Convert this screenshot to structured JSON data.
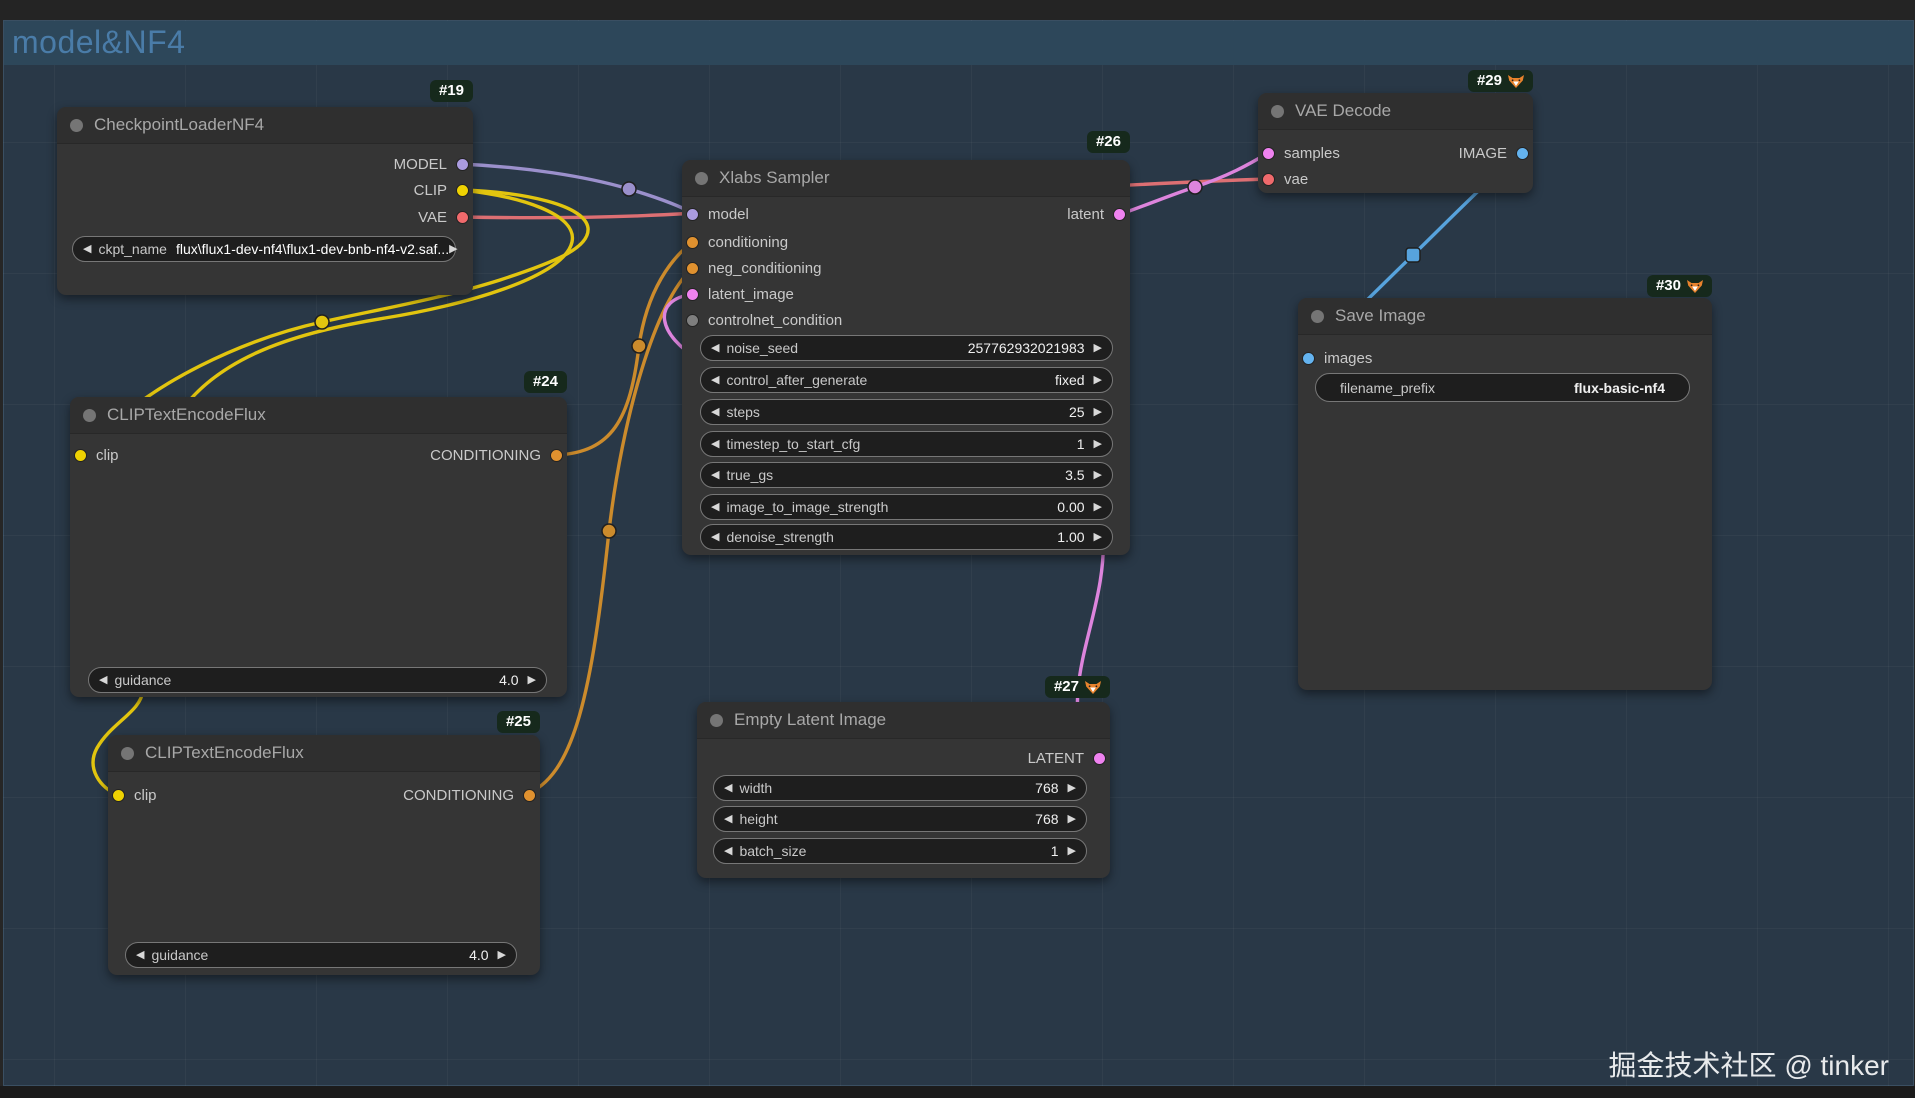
{
  "window": {
    "group_title": "model&NF4",
    "watermark": "掘金技术社区 @ tinker"
  },
  "colors": {
    "group_header": "#2d475a",
    "group_body": "#293847",
    "group_title_text": "#4a7ca8",
    "node_body": "#353535",
    "node_header": "#2f2f2f",
    "badge_bg": "#16291c",
    "slot_model_purple": "#ab9ce0",
    "slot_clip_yellow": "#efd202",
    "slot_vae_red": "#f06a6c",
    "slot_conditioning_orange": "#e0912f",
    "slot_latent_pink": "#ef82ef",
    "slot_controlnet_gray": "#7e7e7e",
    "slot_image_blue": "#64b3ef"
  },
  "nodes": {
    "checkpoint": {
      "badge": "#19",
      "title": "CheckpointLoaderNF4",
      "outputs": [
        "MODEL",
        "CLIP",
        "VAE"
      ],
      "widgets": [
        {
          "label": "ckpt_name",
          "value": "flux\\flux1-dev-nf4\\flux1-dev-bnb-nf4-v2.saf..."
        }
      ]
    },
    "clip_pos": {
      "badge": "#24",
      "title": "CLIPTextEncodeFlux",
      "inputs": [
        "clip"
      ],
      "outputs": [
        "CONDITIONING"
      ],
      "widgets": [
        {
          "label": "guidance",
          "value": "4.0"
        }
      ]
    },
    "clip_neg": {
      "badge": "#25",
      "title": "CLIPTextEncodeFlux",
      "inputs": [
        "clip"
      ],
      "outputs": [
        "CONDITIONING"
      ],
      "widgets": [
        {
          "label": "guidance",
          "value": "4.0"
        }
      ]
    },
    "sampler": {
      "badge": "#26",
      "title": "Xlabs Sampler",
      "inputs": [
        "model",
        "conditioning",
        "neg_conditioning",
        "latent_image",
        "controlnet_condition"
      ],
      "outputs": [
        "latent"
      ],
      "widgets": [
        {
          "label": "noise_seed",
          "value": "257762932021983"
        },
        {
          "label": "control_after_generate",
          "value": "fixed"
        },
        {
          "label": "steps",
          "value": "25"
        },
        {
          "label": "timestep_to_start_cfg",
          "value": "1"
        },
        {
          "label": "true_gs",
          "value": "3.5"
        },
        {
          "label": "image_to_image_strength",
          "value": "0.00"
        },
        {
          "label": "denoise_strength",
          "value": "1.00"
        }
      ]
    },
    "empty_latent": {
      "badge": "#27",
      "title": "Empty Latent Image",
      "outputs": [
        "LATENT"
      ],
      "widgets": [
        {
          "label": "width",
          "value": "768"
        },
        {
          "label": "height",
          "value": "768"
        },
        {
          "label": "batch_size",
          "value": "1"
        }
      ]
    },
    "vae_decode": {
      "badge": "#29",
      "title": "VAE Decode",
      "inputs": [
        "samples",
        "vae"
      ],
      "outputs": [
        "IMAGE"
      ]
    },
    "save_image": {
      "badge": "#30",
      "title": "Save Image",
      "inputs": [
        "images"
      ],
      "widgets": [
        {
          "label": "filename_prefix",
          "value": "flux-basic-nf4"
        }
      ]
    }
  }
}
